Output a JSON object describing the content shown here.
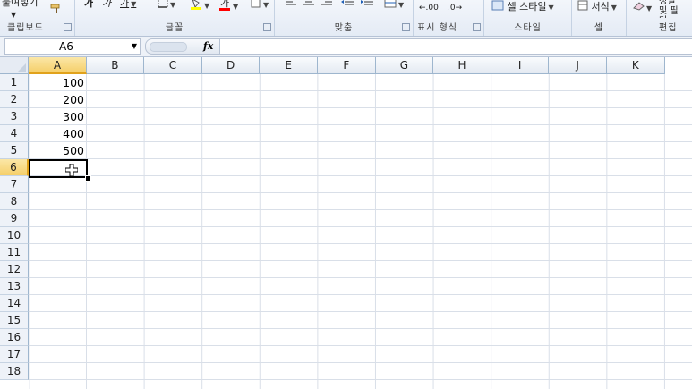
{
  "ribbon": {
    "clipboard": {
      "paste_label": "붙여넣기",
      "label": "클립보드"
    },
    "font": {
      "label": "글꼴",
      "bold": "가",
      "italic": "가",
      "underline": "가"
    },
    "alignment": {
      "label": "맞춤"
    },
    "number": {
      "label": "표시 형식",
      "decimal_inc": ".00",
      "decimal_dec": ".0"
    },
    "styles": {
      "label": "스타일",
      "cell_style": "셀 스타일"
    },
    "cells": {
      "label": "셀",
      "format": "서식"
    },
    "editing": {
      "label": "편집",
      "sort_filter": "정렬 및 필터"
    }
  },
  "formula_bar": {
    "name_box": "A6",
    "fx_label": "fx",
    "formula": ""
  },
  "columns": [
    "A",
    "B",
    "C",
    "D",
    "E",
    "F",
    "G",
    "H",
    "I",
    "J",
    "K"
  ],
  "rows": [
    "1",
    "2",
    "3",
    "4",
    "5",
    "6",
    "7",
    "8",
    "9",
    "10",
    "11",
    "12",
    "13",
    "14",
    "15",
    "16",
    "17",
    "18"
  ],
  "cells": [
    {
      "ref": "A1",
      "value": "100"
    },
    {
      "ref": "A2",
      "value": "200"
    },
    {
      "ref": "A3",
      "value": "300"
    },
    {
      "ref": "A4",
      "value": "400"
    },
    {
      "ref": "A5",
      "value": "500"
    }
  ],
  "active_cell": "A6",
  "colors": {
    "selected_header": "#f5cf6a",
    "grid": "#d9dfe8",
    "ribbon_bg": "#e4ebf5"
  }
}
